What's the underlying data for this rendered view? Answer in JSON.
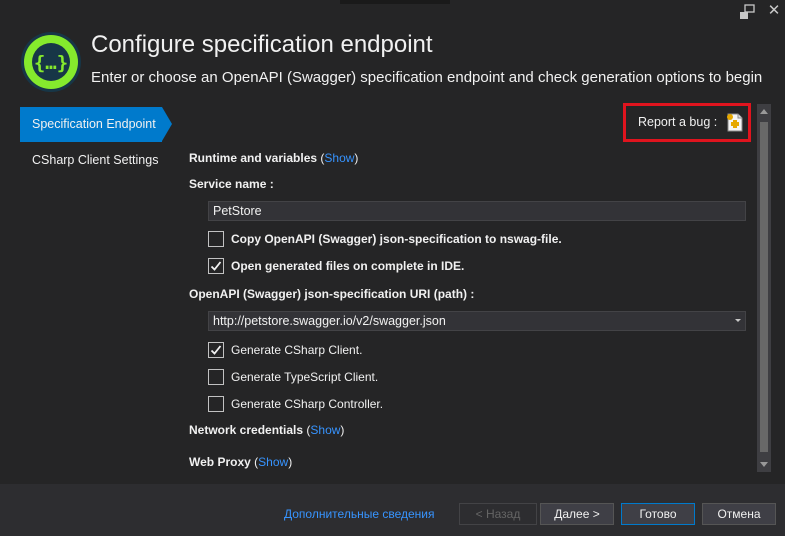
{
  "window": {
    "title": "Configure specification endpoint",
    "subtitle": "Enter or choose an OpenAPI (Swagger) specification endpoint and check generation options to begin"
  },
  "nav": [
    {
      "label": "Specification Endpoint",
      "active": true
    },
    {
      "label": "CSharp Client Settings",
      "active": false
    }
  ],
  "report_bug": {
    "label": "Report a bug :",
    "icon": "report-bug-icon",
    "highlight_color": "#e0141e"
  },
  "runtime": {
    "label": "Runtime and variables",
    "open_paren": "(",
    "show": "Show",
    "close_paren": ")"
  },
  "service_name": {
    "label": "Service name :",
    "value": "PetStore"
  },
  "options": {
    "copy_spec": {
      "label": "Copy OpenAPI (Swagger) json-specification to nswag-file.",
      "checked": false
    },
    "open_files": {
      "label": "Open generated files on complete in IDE.",
      "checked": true
    }
  },
  "spec_uri": {
    "label": "OpenAPI (Swagger) json-specification URI (path) :",
    "value": "http://petstore.swagger.io/v2/swagger.json"
  },
  "generators": {
    "csharp_client": {
      "label": "Generate CSharp Client.",
      "checked": true
    },
    "typescript_client": {
      "label": "Generate TypeScript Client.",
      "checked": false
    },
    "csharp_controller": {
      "label": "Generate CSharp Controller.",
      "checked": false
    }
  },
  "network": {
    "label": "Network credentials",
    "open_paren": "(",
    "show": "Show",
    "close_paren": ")"
  },
  "proxy": {
    "label": "Web Proxy",
    "open_paren": "(",
    "show": "Show",
    "close_paren": ")"
  },
  "footer": {
    "more_info": "Дополнительные сведения",
    "back": "< Назад",
    "next": "Далее >",
    "finish": "Готово",
    "cancel": "Отмена"
  },
  "colors": {
    "accent": "#007acc",
    "link": "#3794ff",
    "background": "#252526"
  }
}
